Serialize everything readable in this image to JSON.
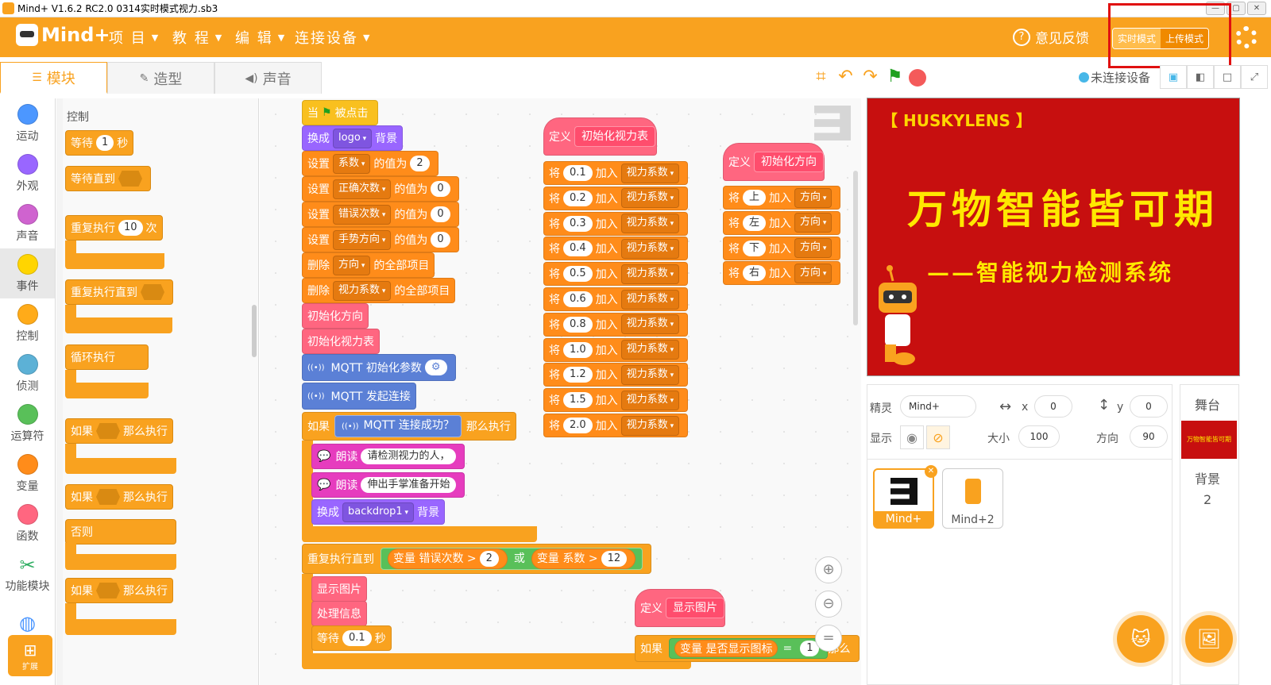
{
  "window": {
    "title": "Mind+ V1.6.2 RC2.0   0314实时模式视力.sb3",
    "controls": [
      "—",
      "▢",
      "✕"
    ]
  },
  "menubar": {
    "logo": "Mind+",
    "items": [
      "项 目",
      "教 程",
      "编 辑",
      "连接设备"
    ],
    "feedback": "意见反馈",
    "mode_realtime": "实时模式",
    "mode_upload": "上传模式"
  },
  "tabs": [
    "模块",
    "造型",
    "声音"
  ],
  "toolbar": {
    "connection": "未连接设备"
  },
  "categories": [
    {
      "label": "运动",
      "color": "#4c97ff"
    },
    {
      "label": "外观",
      "color": "#9966ff"
    },
    {
      "label": "声音",
      "color": "#cf63cf"
    },
    {
      "label": "事件",
      "color": "#ffd500"
    },
    {
      "label": "控制",
      "color": "#ffab19"
    },
    {
      "label": "侦测",
      "color": "#5cb1d6"
    },
    {
      "label": "运算符",
      "color": "#59c059"
    },
    {
      "label": "变量",
      "color": "#ff8c1a"
    },
    {
      "label": "函数",
      "color": "#ff6680"
    },
    {
      "label": "功能模块",
      "color": "#2fae62"
    }
  ],
  "extension": "扩展",
  "palette": {
    "title": "控制",
    "wait": "等待",
    "wait_val": "1",
    "wait_unit": "秒",
    "wait_until": "等待直到",
    "repeat": "重复执行",
    "repeat_val": "10",
    "repeat_unit": "次",
    "repeat_until": "重复执行直到",
    "forever": "循环执行",
    "if": "如果",
    "then": "那么执行",
    "if2": "如果",
    "then2": "那么执行",
    "else": "否则",
    "if3": "如果",
    "then3": "那么执行"
  },
  "script1": {
    "hat": "当",
    "hat_b": "被点击",
    "switch_backdrop": "换成",
    "backdrop_logo": "logo",
    "backdrop_word": "背景",
    "set": "设置",
    "to_value": "的值为",
    "vars": [
      {
        "name": "系数",
        "val": "2"
      },
      {
        "name": "正确次数",
        "val": "0"
      },
      {
        "name": "错误次数",
        "val": "0"
      },
      {
        "name": "手势方向",
        "val": "0"
      }
    ],
    "delete": "删除",
    "delete_all": "的全部项目",
    "list1": "方向",
    "list2": "视力系数",
    "call1": "初始化方向",
    "call2": "初始化视力表",
    "mqtt_init": "MQTT 初始化参数",
    "mqtt_connect": "MQTT 发起连接",
    "if": "如果",
    "mqtt_ok": "MQTT 连接成功？",
    "then": "那么执行",
    "speak": "朗读",
    "speak1": "请检测视力的人，",
    "speak2": "伸出手掌准备开始",
    "switch2": "换成",
    "backdrop1": "backdrop1",
    "bg2": "背景",
    "repeat_until": "重复执行直到",
    "var_word": "变量",
    "err_var": "错误次数",
    "gt": ">",
    "n2": "2",
    "or": "或",
    "coef_var": "系数",
    "n12": "12",
    "show_img": "显示图片",
    "process": "处理信息",
    "wait": "等待",
    "wait_val": "0.1",
    "sec": "秒"
  },
  "script2": {
    "define": "定义",
    "name": "初始化视力表",
    "add_prefix": "将",
    "add_word": "加入",
    "list": "视力系数",
    "values": [
      "0.1",
      "0.2",
      "0.3",
      "0.4",
      "0.5",
      "0.6",
      "0.8",
      "1.0",
      "1.2",
      "1.5",
      "2.0"
    ]
  },
  "script3": {
    "define": "定义",
    "name": "初始化方向",
    "add_prefix": "将",
    "add_word": "加入",
    "list": "方向",
    "values": [
      "上",
      "左",
      "下",
      "右"
    ]
  },
  "script4": {
    "define": "定义",
    "name": "显示图片",
    "if": "如果",
    "var_word": "变量",
    "var": "是否显示图标",
    "eq": "=",
    "val": "1",
    "then": "那么"
  },
  "stage": {
    "header": "【 HUSKYLENS 】",
    "main": "万物智能皆可期",
    "sub": "——智能视力检测系统"
  },
  "sprite_info": {
    "sprite_label": "精灵",
    "sprite_name": "Mind+",
    "x_label": "x",
    "x": "0",
    "y_label": "y",
    "y": "0",
    "show_label": "显示",
    "size_label": "大小",
    "size": "100",
    "dir_label": "方向",
    "dir": "90"
  },
  "sprites": [
    "Mind+",
    "Mind+2"
  ],
  "stage_panel": {
    "title": "舞台",
    "bg_label": "背景",
    "bg_count": "2"
  }
}
